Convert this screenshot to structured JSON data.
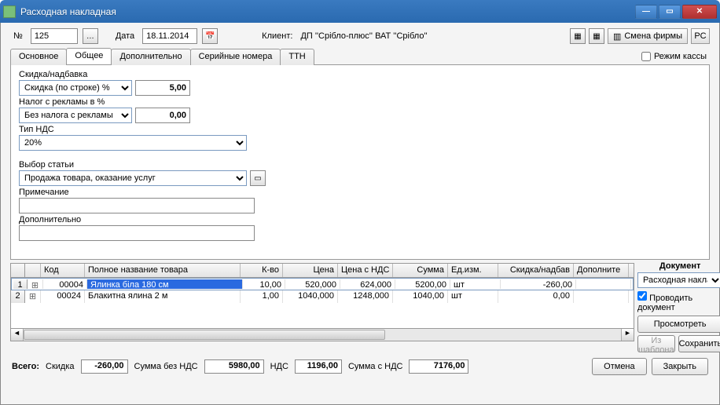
{
  "window": {
    "title": "Расходная накладная"
  },
  "header": {
    "number_label": "№",
    "number": "125",
    "date_label": "Дата",
    "date": "18.11.2014",
    "client_label": "Клиент:",
    "client": "ДП ''Срібло-плюс'' ВАТ ''Срібло''",
    "firm_btn": "Смена фирмы",
    "rc_btn": "РС",
    "rezhim_kassy": "Режим кассы"
  },
  "tabs": [
    "Основное",
    "Общее",
    "Дополнительно",
    "Серийные номера",
    "ТТН"
  ],
  "form": {
    "discount_label": "Скидка/надбавка",
    "discount_mode": "Скидка (по строке)  %",
    "discount_value": "5,00",
    "adtax_label": "Налог с рекламы в %",
    "adtax_mode": "Без налога с рекламы",
    "adtax_value": "0,00",
    "vat_label": "Тип НДС",
    "vat_value": "20%",
    "article_label": "Выбор статьи",
    "article_value": "Продажа товара, оказание услуг",
    "note_label": "Примечание",
    "note_value": "",
    "extra_label": "Дополнительно",
    "extra_value": ""
  },
  "grid": {
    "headers": {
      "code": "Код",
      "name": "Полное название товара",
      "qty": "К-во",
      "price": "Цена",
      "price_vat": "Цена с НДС",
      "sum": "Сумма",
      "unit": "Ед.изм.",
      "disc": "Скидка/надбав",
      "extra": "Дополните"
    },
    "rows": [
      {
        "idx": "1",
        "code": "00004",
        "name": "Ялинка біла 180 см",
        "qty": "10,00",
        "price": "520,000",
        "price_vat": "624,000",
        "sum": "5200,00",
        "unit": "шт",
        "disc": "-260,00",
        "extra": ""
      },
      {
        "idx": "2",
        "code": "00024",
        "name": "Блакитна ялина 2 м",
        "qty": "1,00",
        "price": "1040,000",
        "price_vat": "1248,000",
        "sum": "1040,00",
        "unit": "шт",
        "disc": "0,00",
        "extra": ""
      }
    ]
  },
  "sidebar": {
    "title": "Документ",
    "doc_type": "Расходная накладная",
    "post_doc": "Проводить документ",
    "preview": "Просмотреть",
    "from_template": "Из шаблона",
    "save": "Сохранить"
  },
  "totals": {
    "total_label": "Всего:",
    "discount_label": "Скидка",
    "discount": "-260,00",
    "sum_novat_label": "Сумма без НДС",
    "sum_novat": "5980,00",
    "vat_label": "НДС",
    "vat": "1196,00",
    "sum_vat_label": "Сумма с НДС",
    "sum_vat": "7176,00",
    "cancel": "Отмена",
    "close": "Закрыть"
  }
}
